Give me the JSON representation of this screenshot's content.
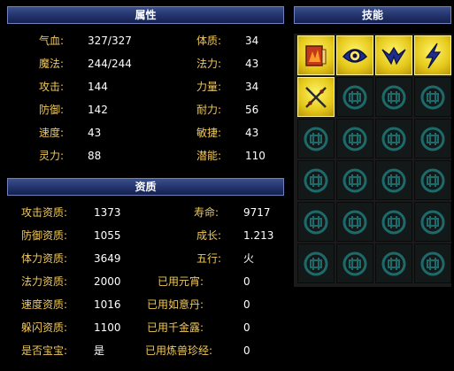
{
  "attributes": {
    "title": "属性",
    "rows": [
      {
        "label": "气血:",
        "value": "327/327"
      },
      {
        "label": "魔法:",
        "value": "244/244"
      },
      {
        "label": "攻击:",
        "value": "144"
      },
      {
        "label": "防御:",
        "value": "142"
      },
      {
        "label": "速度:",
        "value": "43"
      },
      {
        "label": "灵力:",
        "value": "88"
      }
    ],
    "rows_right": [
      {
        "label": "体质:",
        "value": "34"
      },
      {
        "label": "法力:",
        "value": "43"
      },
      {
        "label": "力量:",
        "value": "34"
      },
      {
        "label": "耐力:",
        "value": "56"
      },
      {
        "label": "敏捷:",
        "value": "43"
      },
      {
        "label": "潜能:",
        "value": "110"
      }
    ]
  },
  "aptitude": {
    "title": "资质",
    "rows": [
      {
        "label": "攻击资质:",
        "value": "1373"
      },
      {
        "label": "防御资质:",
        "value": "1055"
      },
      {
        "label": "体力资质:",
        "value": "3649"
      },
      {
        "label": "法力资质:",
        "value": "2000"
      },
      {
        "label": "速度资质:",
        "value": "1016"
      },
      {
        "label": "躲闪资质:",
        "value": "1100"
      },
      {
        "label": "是否宝宝:",
        "value": "是"
      }
    ],
    "rows_right": [
      {
        "label": "寿命:",
        "value": "9717"
      },
      {
        "label": "成长:",
        "value": "1.213"
      },
      {
        "label": "五行:",
        "value": "火"
      },
      {
        "label": "已用元宵:",
        "value": "0"
      },
      {
        "label": "已用如意丹:",
        "value": "0"
      },
      {
        "label": "已用千金露:",
        "value": "0"
      },
      {
        "label": "已用炼兽珍经:",
        "value": "0"
      }
    ]
  },
  "skills": {
    "title": "技能",
    "slots": [
      {
        "icon": "skill-fire-shield-icon",
        "filled": true
      },
      {
        "icon": "skill-eye-icon",
        "filled": true
      },
      {
        "icon": "skill-wings-icon",
        "filled": true
      },
      {
        "icon": "skill-lightning-icon",
        "filled": true
      },
      {
        "icon": "skill-crossed-swords-icon",
        "filled": true
      },
      {
        "icon": "empty-slot-icon",
        "filled": false
      },
      {
        "icon": "empty-slot-icon",
        "filled": false
      },
      {
        "icon": "empty-slot-icon",
        "filled": false
      },
      {
        "icon": "empty-slot-icon",
        "filled": false
      },
      {
        "icon": "empty-slot-icon",
        "filled": false
      },
      {
        "icon": "empty-slot-icon",
        "filled": false
      },
      {
        "icon": "empty-slot-icon",
        "filled": false
      },
      {
        "icon": "empty-slot-icon",
        "filled": false
      },
      {
        "icon": "empty-slot-icon",
        "filled": false
      },
      {
        "icon": "empty-slot-icon",
        "filled": false
      },
      {
        "icon": "empty-slot-icon",
        "filled": false
      },
      {
        "icon": "empty-slot-icon",
        "filled": false
      },
      {
        "icon": "empty-slot-icon",
        "filled": false
      },
      {
        "icon": "empty-slot-icon",
        "filled": false
      },
      {
        "icon": "empty-slot-icon",
        "filled": false
      },
      {
        "icon": "empty-slot-icon",
        "filled": false
      },
      {
        "icon": "empty-slot-icon",
        "filled": false
      },
      {
        "icon": "empty-slot-icon",
        "filled": false
      },
      {
        "icon": "empty-slot-icon",
        "filled": false
      }
    ]
  },
  "colors": {
    "label": "#f0c85a",
    "value": "#ffffff",
    "header": "#22336c",
    "slot_gold": "#e5c81a",
    "slot_empty": "#1e6a6a"
  }
}
